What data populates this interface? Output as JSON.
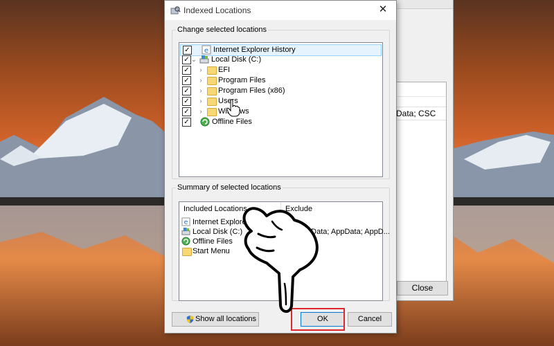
{
  "dialog": {
    "title": "Indexed Locations",
    "close_glyph": "✕",
    "change_group_label": "Change selected locations",
    "summary_group_label": "Summary of selected locations",
    "tree": [
      {
        "label": "Internet Explorer History",
        "checked": true,
        "icon": "ie-history-icon"
      },
      {
        "label": "Local Disk (C:)",
        "checked": true,
        "icon": "local-disk-icon",
        "expanded": true
      },
      {
        "label": "EFI",
        "checked": true,
        "icon": "folder-icon"
      },
      {
        "label": "Program Files",
        "checked": true,
        "icon": "folder-icon"
      },
      {
        "label": "Program Files (x86)",
        "checked": true,
        "icon": "folder-icon"
      },
      {
        "label": "Users",
        "checked": true,
        "icon": "folder-icon"
      },
      {
        "label": "Windows",
        "checked": true,
        "icon": "folder-icon"
      },
      {
        "label": "Offline Files",
        "checked": true,
        "icon": "offline-files-icon"
      }
    ],
    "summary": {
      "col_included": "Included Locations",
      "col_exclude": "Exclude",
      "rows": [
        {
          "included": "Internet Explorer History",
          "exclude": ""
        },
        {
          "included": "Local Disk (C:)",
          "exclude": "ogramData; AppData; AppD..."
        },
        {
          "included": "Offline Files",
          "exclude": ""
        },
        {
          "included": "Start Menu",
          "exclude": ""
        }
      ]
    },
    "buttons": {
      "show_all": "Show all locations",
      "ok": "OK",
      "cancel": "Cancel"
    }
  },
  "background_window": {
    "row_text": "Data; CSC",
    "close_label": "Close"
  },
  "colors": {
    "highlight_box": "#e0252b",
    "selection": "#e5f3ff",
    "ok_border": "#0078d7"
  }
}
